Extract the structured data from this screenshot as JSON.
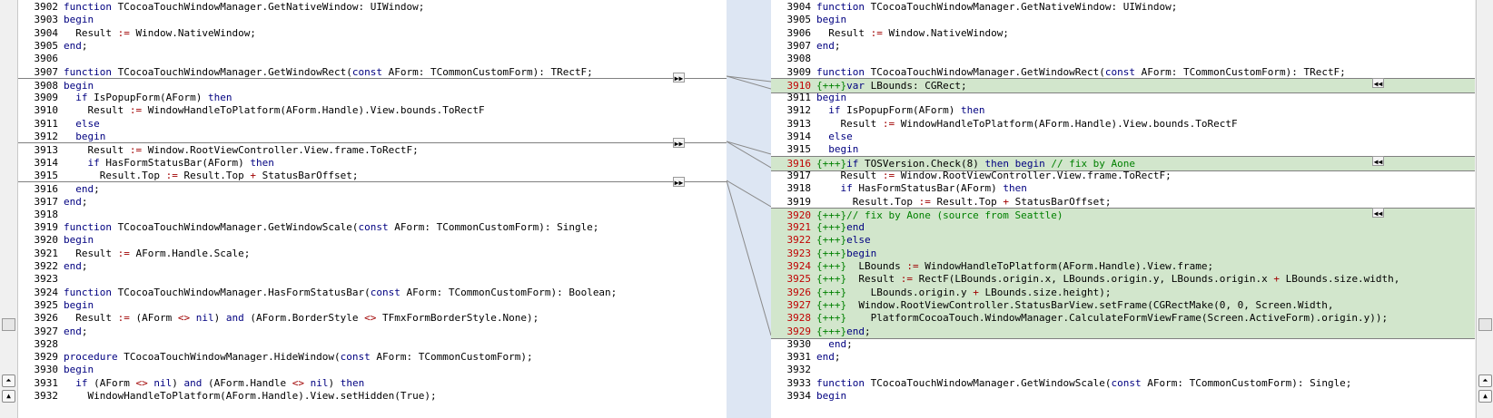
{
  "icons": {
    "copy_right": "▶▶",
    "copy_left": "◀◀",
    "scroll_up": "▲",
    "scroll_up_fast": "⏶"
  },
  "left_lines": [
    {
      "n": "3902",
      "code": [
        [
          "kw",
          "function"
        ],
        [
          "t",
          " TCocoaTouchWindowManager.GetNativeWindow: UIWindow;"
        ]
      ]
    },
    {
      "n": "3903",
      "code": [
        [
          "kw",
          "begin"
        ]
      ]
    },
    {
      "n": "3904",
      "code": [
        [
          "t",
          "  Result "
        ],
        [
          "op",
          ":="
        ],
        [
          "t",
          " Window.NativeWindow;"
        ]
      ]
    },
    {
      "n": "3905",
      "code": [
        [
          "kw",
          "end"
        ],
        [
          "t",
          ";"
        ]
      ]
    },
    {
      "n": "3906",
      "code": []
    },
    {
      "n": "3907",
      "code": [
        [
          "kw",
          "function"
        ],
        [
          "t",
          " TCocoaTouchWindowManager.GetWindowRect("
        ],
        [
          "kw",
          "const"
        ],
        [
          "t",
          " AForm: TCommonCustomForm): TRectF;"
        ]
      ]
    },
    {
      "n": "3908",
      "code": [
        [
          "kw",
          "begin"
        ]
      ]
    },
    {
      "n": "3909",
      "code": [
        [
          "t",
          "  "
        ],
        [
          "kw",
          "if"
        ],
        [
          "t",
          " IsPopupForm(AForm) "
        ],
        [
          "kw",
          "then"
        ]
      ]
    },
    {
      "n": "3910",
      "code": [
        [
          "t",
          "    Result "
        ],
        [
          "op",
          ":="
        ],
        [
          "t",
          " WindowHandleToPlatform(AForm.Handle).View.bounds.ToRectF"
        ]
      ]
    },
    {
      "n": "3911",
      "code": [
        [
          "t",
          "  "
        ],
        [
          "kw",
          "else"
        ]
      ]
    },
    {
      "n": "3912",
      "code": [
        [
          "t",
          "  "
        ],
        [
          "kw",
          "begin"
        ]
      ]
    },
    {
      "n": "3913",
      "code": [
        [
          "t",
          "    Result "
        ],
        [
          "op",
          ":="
        ],
        [
          "t",
          " Window.RootViewController.View.frame.ToRectF;"
        ]
      ]
    },
    {
      "n": "3914",
      "code": [
        [
          "t",
          "    "
        ],
        [
          "kw",
          "if"
        ],
        [
          "t",
          " HasFormStatusBar(AForm) "
        ],
        [
          "kw",
          "then"
        ]
      ]
    },
    {
      "n": "3915",
      "code": [
        [
          "t",
          "      Result.Top "
        ],
        [
          "op",
          ":="
        ],
        [
          "t",
          " Result.Top "
        ],
        [
          "op",
          "+"
        ],
        [
          "t",
          " StatusBarOffset;"
        ]
      ]
    },
    {
      "n": "3916",
      "code": [
        [
          "t",
          "  "
        ],
        [
          "kw",
          "end"
        ],
        [
          "t",
          ";"
        ]
      ]
    },
    {
      "n": "3917",
      "code": [
        [
          "kw",
          "end"
        ],
        [
          "t",
          ";"
        ]
      ]
    },
    {
      "n": "3918",
      "code": []
    },
    {
      "n": "3919",
      "code": [
        [
          "kw",
          "function"
        ],
        [
          "t",
          " TCocoaTouchWindowManager.GetWindowScale("
        ],
        [
          "kw",
          "const"
        ],
        [
          "t",
          " AForm: TCommonCustomForm): Single;"
        ]
      ]
    },
    {
      "n": "3920",
      "code": [
        [
          "kw",
          "begin"
        ]
      ]
    },
    {
      "n": "3921",
      "code": [
        [
          "t",
          "  Result "
        ],
        [
          "op",
          ":="
        ],
        [
          "t",
          " AForm.Handle.Scale;"
        ]
      ]
    },
    {
      "n": "3922",
      "code": [
        [
          "kw",
          "end"
        ],
        [
          "t",
          ";"
        ]
      ]
    },
    {
      "n": "3923",
      "code": []
    },
    {
      "n": "3924",
      "code": [
        [
          "kw",
          "function"
        ],
        [
          "t",
          " TCocoaTouchWindowManager.HasFormStatusBar("
        ],
        [
          "kw",
          "const"
        ],
        [
          "t",
          " AForm: TCommonCustomForm): Boolean;"
        ]
      ]
    },
    {
      "n": "3925",
      "code": [
        [
          "kw",
          "begin"
        ]
      ]
    },
    {
      "n": "3926",
      "code": [
        [
          "t",
          "  Result "
        ],
        [
          "op",
          ":="
        ],
        [
          "t",
          " (AForm "
        ],
        [
          "op",
          "<>"
        ],
        [
          "t",
          " "
        ],
        [
          "kw",
          "nil"
        ],
        [
          "t",
          ") "
        ],
        [
          "kw",
          "and"
        ],
        [
          "t",
          " (AForm.BorderStyle "
        ],
        [
          "op",
          "<>"
        ],
        [
          "t",
          " TFmxFormBorderStyle.None);"
        ]
      ]
    },
    {
      "n": "3927",
      "code": [
        [
          "kw",
          "end"
        ],
        [
          "t",
          ";"
        ]
      ]
    },
    {
      "n": "3928",
      "code": []
    },
    {
      "n": "3929",
      "code": [
        [
          "kw",
          "procedure"
        ],
        [
          "t",
          " TCocoaTouchWindowManager.HideWindow("
        ],
        [
          "kw",
          "const"
        ],
        [
          "t",
          " AForm: TCommonCustomForm);"
        ]
      ]
    },
    {
      "n": "3930",
      "code": [
        [
          "kw",
          "begin"
        ]
      ]
    },
    {
      "n": "3931",
      "code": [
        [
          "t",
          "  "
        ],
        [
          "kw",
          "if"
        ],
        [
          "t",
          " (AForm "
        ],
        [
          "op",
          "<>"
        ],
        [
          "t",
          " "
        ],
        [
          "kw",
          "nil"
        ],
        [
          "t",
          ") "
        ],
        [
          "kw",
          "and"
        ],
        [
          "t",
          " (AForm.Handle "
        ],
        [
          "op",
          "<>"
        ],
        [
          "t",
          " "
        ],
        [
          "kw",
          "nil"
        ],
        [
          "t",
          ") "
        ],
        [
          "kw",
          "then"
        ]
      ]
    },
    {
      "n": "3932",
      "code": [
        [
          "t",
          "    WindowHandleToPlatform(AForm.Handle).View.setHidden(True);"
        ]
      ]
    }
  ],
  "right_lines": [
    {
      "n": "3904",
      "code": [
        [
          "kw",
          "function"
        ],
        [
          "t",
          " TCocoaTouchWindowManager.GetNativeWindow: UIWindow;"
        ]
      ]
    },
    {
      "n": "3905",
      "code": [
        [
          "kw",
          "begin"
        ]
      ]
    },
    {
      "n": "3906",
      "code": [
        [
          "t",
          "  Result "
        ],
        [
          "op",
          ":="
        ],
        [
          "t",
          " Window.NativeWindow;"
        ]
      ]
    },
    {
      "n": "3907",
      "code": [
        [
          "kw",
          "end"
        ],
        [
          "t",
          ";"
        ]
      ]
    },
    {
      "n": "3908",
      "code": []
    },
    {
      "n": "3909",
      "code": [
        [
          "kw",
          "function"
        ],
        [
          "t",
          " TCocoaTouchWindowManager.GetWindowRect("
        ],
        [
          "kw",
          "const"
        ],
        [
          "t",
          " AForm: TCommonCustomForm): TRectF;"
        ]
      ]
    },
    {
      "n": "3910",
      "added": true,
      "code": [
        [
          "grn",
          "{+++}"
        ],
        [
          "kw",
          "var"
        ],
        [
          "t",
          " LBounds: CGRect;"
        ]
      ]
    },
    {
      "n": "3911",
      "code": [
        [
          "kw",
          "begin"
        ]
      ]
    },
    {
      "n": "3912",
      "code": [
        [
          "t",
          "  "
        ],
        [
          "kw",
          "if"
        ],
        [
          "t",
          " IsPopupForm(AForm) "
        ],
        [
          "kw",
          "then"
        ]
      ]
    },
    {
      "n": "3913",
      "code": [
        [
          "t",
          "    Result "
        ],
        [
          "op",
          ":="
        ],
        [
          "t",
          " WindowHandleToPlatform(AForm.Handle).View.bounds.ToRectF"
        ]
      ]
    },
    {
      "n": "3914",
      "code": [
        [
          "t",
          "  "
        ],
        [
          "kw",
          "else"
        ]
      ]
    },
    {
      "n": "3915",
      "code": [
        [
          "t",
          "  "
        ],
        [
          "kw",
          "begin"
        ]
      ]
    },
    {
      "n": "3916",
      "added": true,
      "code": [
        [
          "grn",
          "{+++}"
        ],
        [
          "kw",
          "if"
        ],
        [
          "t",
          " TOSVersion.Check(8) "
        ],
        [
          "kw",
          "then"
        ],
        [
          "t",
          " "
        ],
        [
          "kw",
          "begin"
        ],
        [
          "t",
          " "
        ],
        [
          "grn",
          "// fix by Aone"
        ]
      ]
    },
    {
      "n": "3917",
      "code": [
        [
          "t",
          "    Result "
        ],
        [
          "op",
          ":="
        ],
        [
          "t",
          " Window.RootViewController.View.frame.ToRectF;"
        ]
      ]
    },
    {
      "n": "3918",
      "code": [
        [
          "t",
          "    "
        ],
        [
          "kw",
          "if"
        ],
        [
          "t",
          " HasFormStatusBar(AForm) "
        ],
        [
          "kw",
          "then"
        ]
      ]
    },
    {
      "n": "3919",
      "code": [
        [
          "t",
          "      Result.Top "
        ],
        [
          "op",
          ":="
        ],
        [
          "t",
          " Result.Top "
        ],
        [
          "op",
          "+"
        ],
        [
          "t",
          " StatusBarOffset;"
        ]
      ]
    },
    {
      "n": "3920",
      "added": true,
      "code": [
        [
          "grn",
          "{+++}// fix by Aone (source from Seattle)"
        ]
      ]
    },
    {
      "n": "3921",
      "added": true,
      "code": [
        [
          "grn",
          "{+++}"
        ],
        [
          "kw",
          "end"
        ]
      ]
    },
    {
      "n": "3922",
      "added": true,
      "code": [
        [
          "grn",
          "{+++}"
        ],
        [
          "kw",
          "else"
        ]
      ]
    },
    {
      "n": "3923",
      "added": true,
      "code": [
        [
          "grn",
          "{+++}"
        ],
        [
          "kw",
          "begin"
        ]
      ]
    },
    {
      "n": "3924",
      "added": true,
      "code": [
        [
          "grn",
          "{+++}"
        ],
        [
          "t",
          "  LBounds "
        ],
        [
          "op",
          ":="
        ],
        [
          "t",
          " WindowHandleToPlatform(AForm.Handle).View.frame;"
        ]
      ]
    },
    {
      "n": "3925",
      "added": true,
      "code": [
        [
          "grn",
          "{+++}"
        ],
        [
          "t",
          "  Result "
        ],
        [
          "op",
          ":="
        ],
        [
          "t",
          " RectF(LBounds.origin.x, LBounds.origin.y, LBounds.origin.x "
        ],
        [
          "op",
          "+"
        ],
        [
          "t",
          " LBounds.size.width,"
        ]
      ]
    },
    {
      "n": "3926",
      "added": true,
      "code": [
        [
          "grn",
          "{+++}"
        ],
        [
          "t",
          "    LBounds.origin.y "
        ],
        [
          "op",
          "+"
        ],
        [
          "t",
          " LBounds.size.height);"
        ]
      ]
    },
    {
      "n": "3927",
      "added": true,
      "code": [
        [
          "grn",
          "{+++}"
        ],
        [
          "t",
          "  Window.RootViewController.StatusBarView.setFrame(CGRectMake(0, 0, Screen.Width,"
        ]
      ]
    },
    {
      "n": "3928",
      "added": true,
      "code": [
        [
          "grn",
          "{+++}"
        ],
        [
          "t",
          "    PlatformCocoaTouch.WindowManager.CalculateFormViewFrame(Screen.ActiveForm).origin.y));"
        ]
      ]
    },
    {
      "n": "3929",
      "added": true,
      "code": [
        [
          "grn",
          "{+++}"
        ],
        [
          "kw",
          "end"
        ],
        [
          "t",
          ";"
        ]
      ]
    },
    {
      "n": "3930",
      "code": [
        [
          "t",
          "  "
        ],
        [
          "kw",
          "end"
        ],
        [
          "t",
          ";"
        ]
      ]
    },
    {
      "n": "3931",
      "code": [
        [
          "kw",
          "end"
        ],
        [
          "t",
          ";"
        ]
      ]
    },
    {
      "n": "3932",
      "code": []
    },
    {
      "n": "3933",
      "code": [
        [
          "kw",
          "function"
        ],
        [
          "t",
          " TCocoaTouchWindowManager.GetWindowScale("
        ],
        [
          "kw",
          "const"
        ],
        [
          "t",
          " AForm: TCommonCustomForm): Single;"
        ]
      ]
    },
    {
      "n": "3934",
      "code": [
        [
          "kw",
          "begin"
        ]
      ]
    }
  ]
}
